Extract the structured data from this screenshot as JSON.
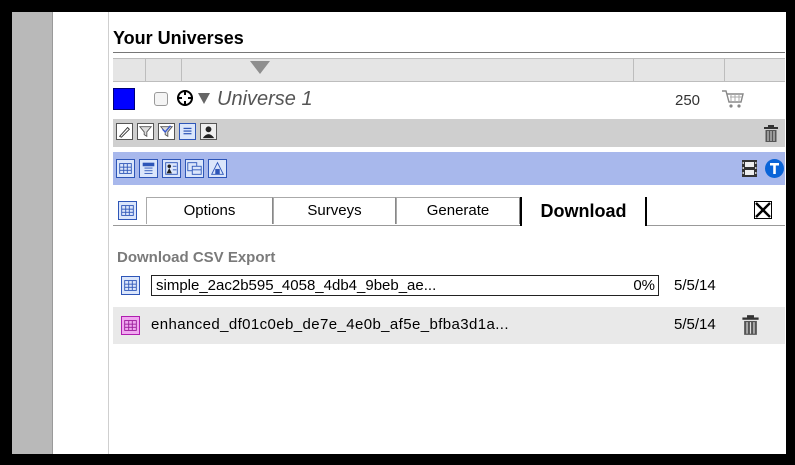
{
  "panel": {
    "title": "Your Universes"
  },
  "universe": {
    "name": "Universe 1",
    "count": "250",
    "color": "#0000ff",
    "icons": [
      "checkbox-icon",
      "target-icon",
      "collapse-triangle-icon",
      "cart-icon"
    ]
  },
  "toolbar1": {
    "icons": [
      "pencil-icon",
      "filter-icon",
      "filter-check-icon",
      "list-icon",
      "person-icon",
      "trash-icon"
    ]
  },
  "toolbar2": {
    "icons": [
      "table-icon",
      "table-header-icon",
      "report-icon",
      "copy-table-icon",
      "building-icon",
      "film-icon",
      "info-icon"
    ],
    "background": "#a8b8ec"
  },
  "tabs": [
    {
      "label": "Options"
    },
    {
      "label": "Surveys"
    },
    {
      "label": "Generate"
    },
    {
      "label": "Download",
      "active": true
    }
  ],
  "download": {
    "section_title": "Download CSV Export",
    "files": [
      {
        "name": "simple_2ac2b595_4058_4db4_9beb_ae...",
        "progress": "0%",
        "date": "5/5/14"
      },
      {
        "name": "enhanced_df01c0eb_de7e_4e0b_af5e_bfba3d1a...",
        "date": "5/5/14"
      }
    ]
  }
}
